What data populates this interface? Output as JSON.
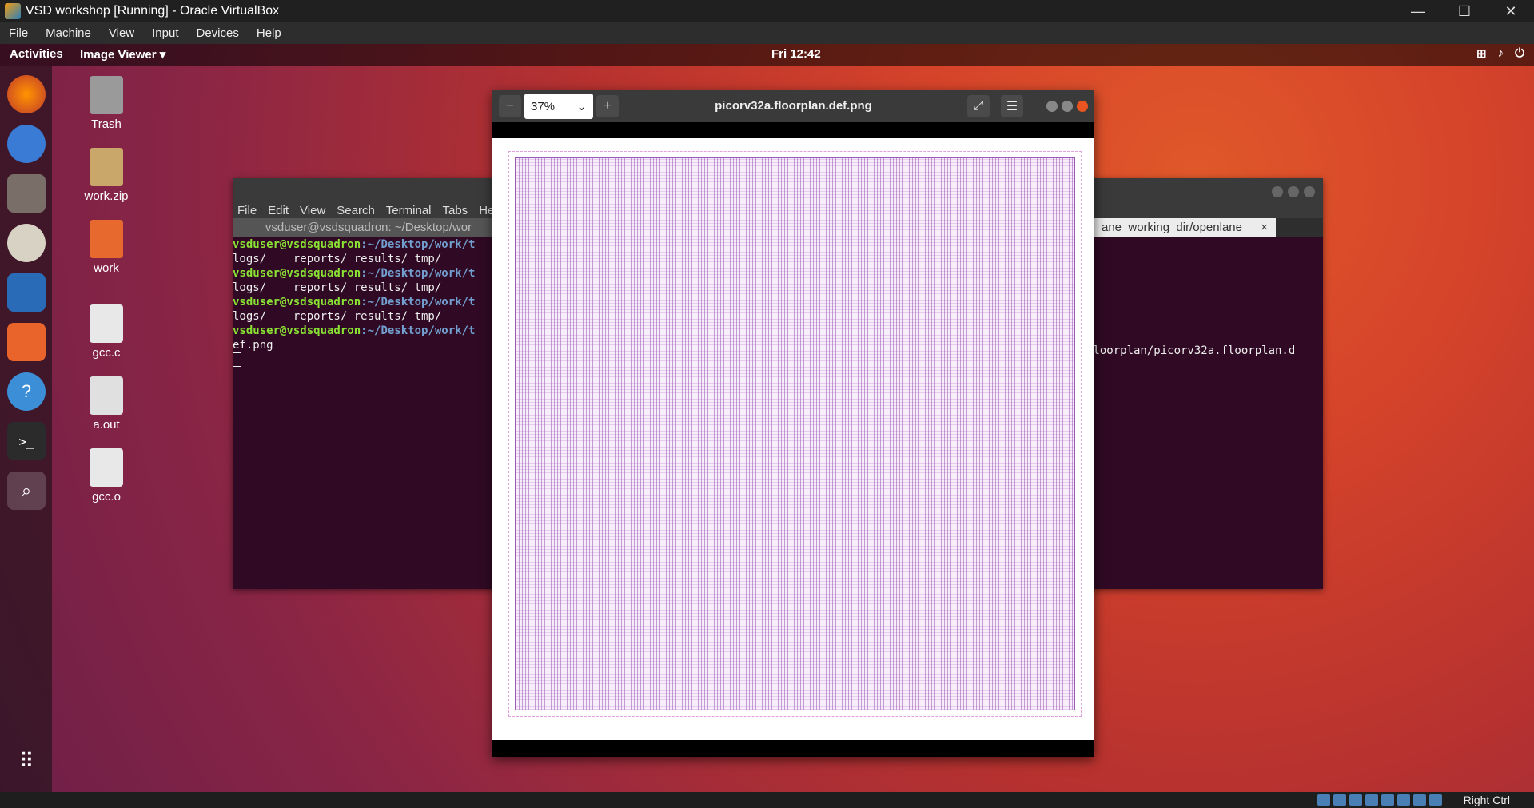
{
  "vbox": {
    "title": "VSD workshop [Running] - Oracle VirtualBox",
    "menu": [
      "File",
      "Machine",
      "View",
      "Input",
      "Devices",
      "Help"
    ],
    "host_key": "Right Ctrl"
  },
  "topbar": {
    "activities": "Activities",
    "app_menu": "Image Viewer ▾",
    "clock": "Fri 12:42"
  },
  "desktop_icons": [
    {
      "label": "Trash"
    },
    {
      "label": "work.zip"
    },
    {
      "label": "work"
    },
    {
      "label": "gcc.c"
    },
    {
      "label": "a.out"
    },
    {
      "label": "gcc.o"
    }
  ],
  "terminal": {
    "menu": [
      "File",
      "Edit",
      "View",
      "Search",
      "Terminal",
      "Tabs",
      "Help"
    ],
    "tab1": "vsduser@vsdsquadron: ~/Desktop/wor",
    "tab2": "ane_working_dir/openlane",
    "tab2_close": "×",
    "lines": [
      {
        "user": "vsduser@vsdsquadron",
        "path": ":~/Desktop/work/t"
      },
      {
        "text": "logs/    reports/ results/ tmp/"
      },
      {
        "user": "vsduser@vsdsquadron",
        "path": ":~/Desktop/work/t"
      },
      {
        "text": "logs/    reports/ results/ tmp/"
      },
      {
        "user": "vsduser@vsdsquadron",
        "path": ":~/Desktop/work/t"
      },
      {
        "text": "logs/    reports/ results/ tmp/"
      },
      {
        "user": "vsduser@vsdsquadron",
        "path": ":~/Desktop/work/t"
      },
      {
        "text": "ef.png"
      }
    ],
    "right_text": "floorplan/picorv32a.floorplan.d"
  },
  "viewer": {
    "zoom": "37%",
    "title": "picorv32a.floorplan.def.png"
  }
}
